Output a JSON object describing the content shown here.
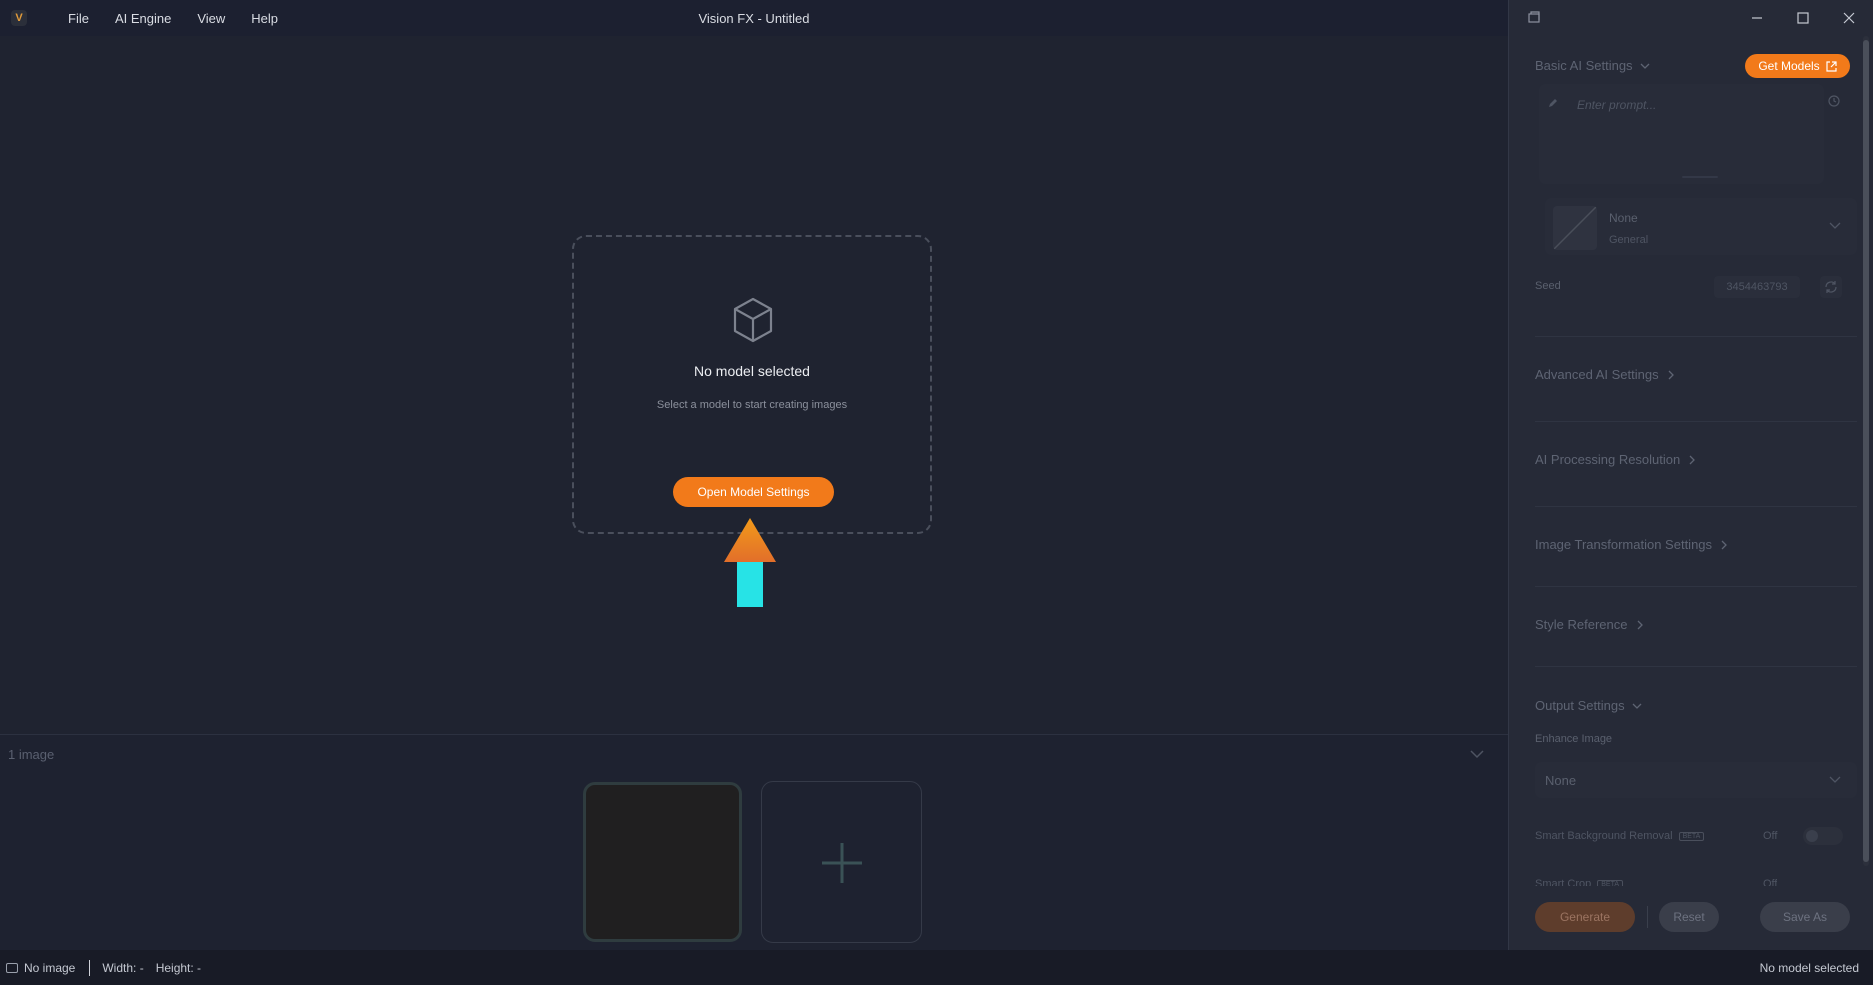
{
  "app": {
    "title": "Vision FX - Untitled",
    "logo_letter": "V",
    "menu": [
      "File",
      "AI Engine",
      "View",
      "Help"
    ]
  },
  "canvas": {
    "empty_title": "No model selected",
    "empty_subtitle": "Select a model to start creating images",
    "open_button": "Open Model Settings"
  },
  "filmstrip": {
    "count_label": "1 image"
  },
  "status": {
    "image_label": "No image",
    "width_label": "Width: -",
    "height_label": "Height: -",
    "model_label": "No model selected"
  },
  "panel": {
    "basic_settings": "Basic AI Settings",
    "get_models": "Get Models",
    "prompt_placeholder": "Enter prompt...",
    "style_name": "None",
    "style_category": "General",
    "seed_label": "Seed",
    "seed_value": "3454463793",
    "advanced_settings": "Advanced AI Settings",
    "processing_resolution": "AI Processing Resolution",
    "transformation_settings": "Image Transformation Settings",
    "style_reference": "Style Reference",
    "output_settings": "Output Settings",
    "enhance_label": "Enhance Image",
    "enhance_value": "None",
    "bg_removal_label": "Smart Background Removal",
    "bg_removal_state": "Off",
    "smart_crop_label": "Smart Crop",
    "smart_crop_state": "Off",
    "beta": "BETA",
    "generate": "Generate",
    "reset": "Reset",
    "save_as": "Save As"
  },
  "colors": {
    "accent": "#f27a1a",
    "arrow_tip": "#f08a1e",
    "arrow_shaft": "#27e3e6"
  }
}
